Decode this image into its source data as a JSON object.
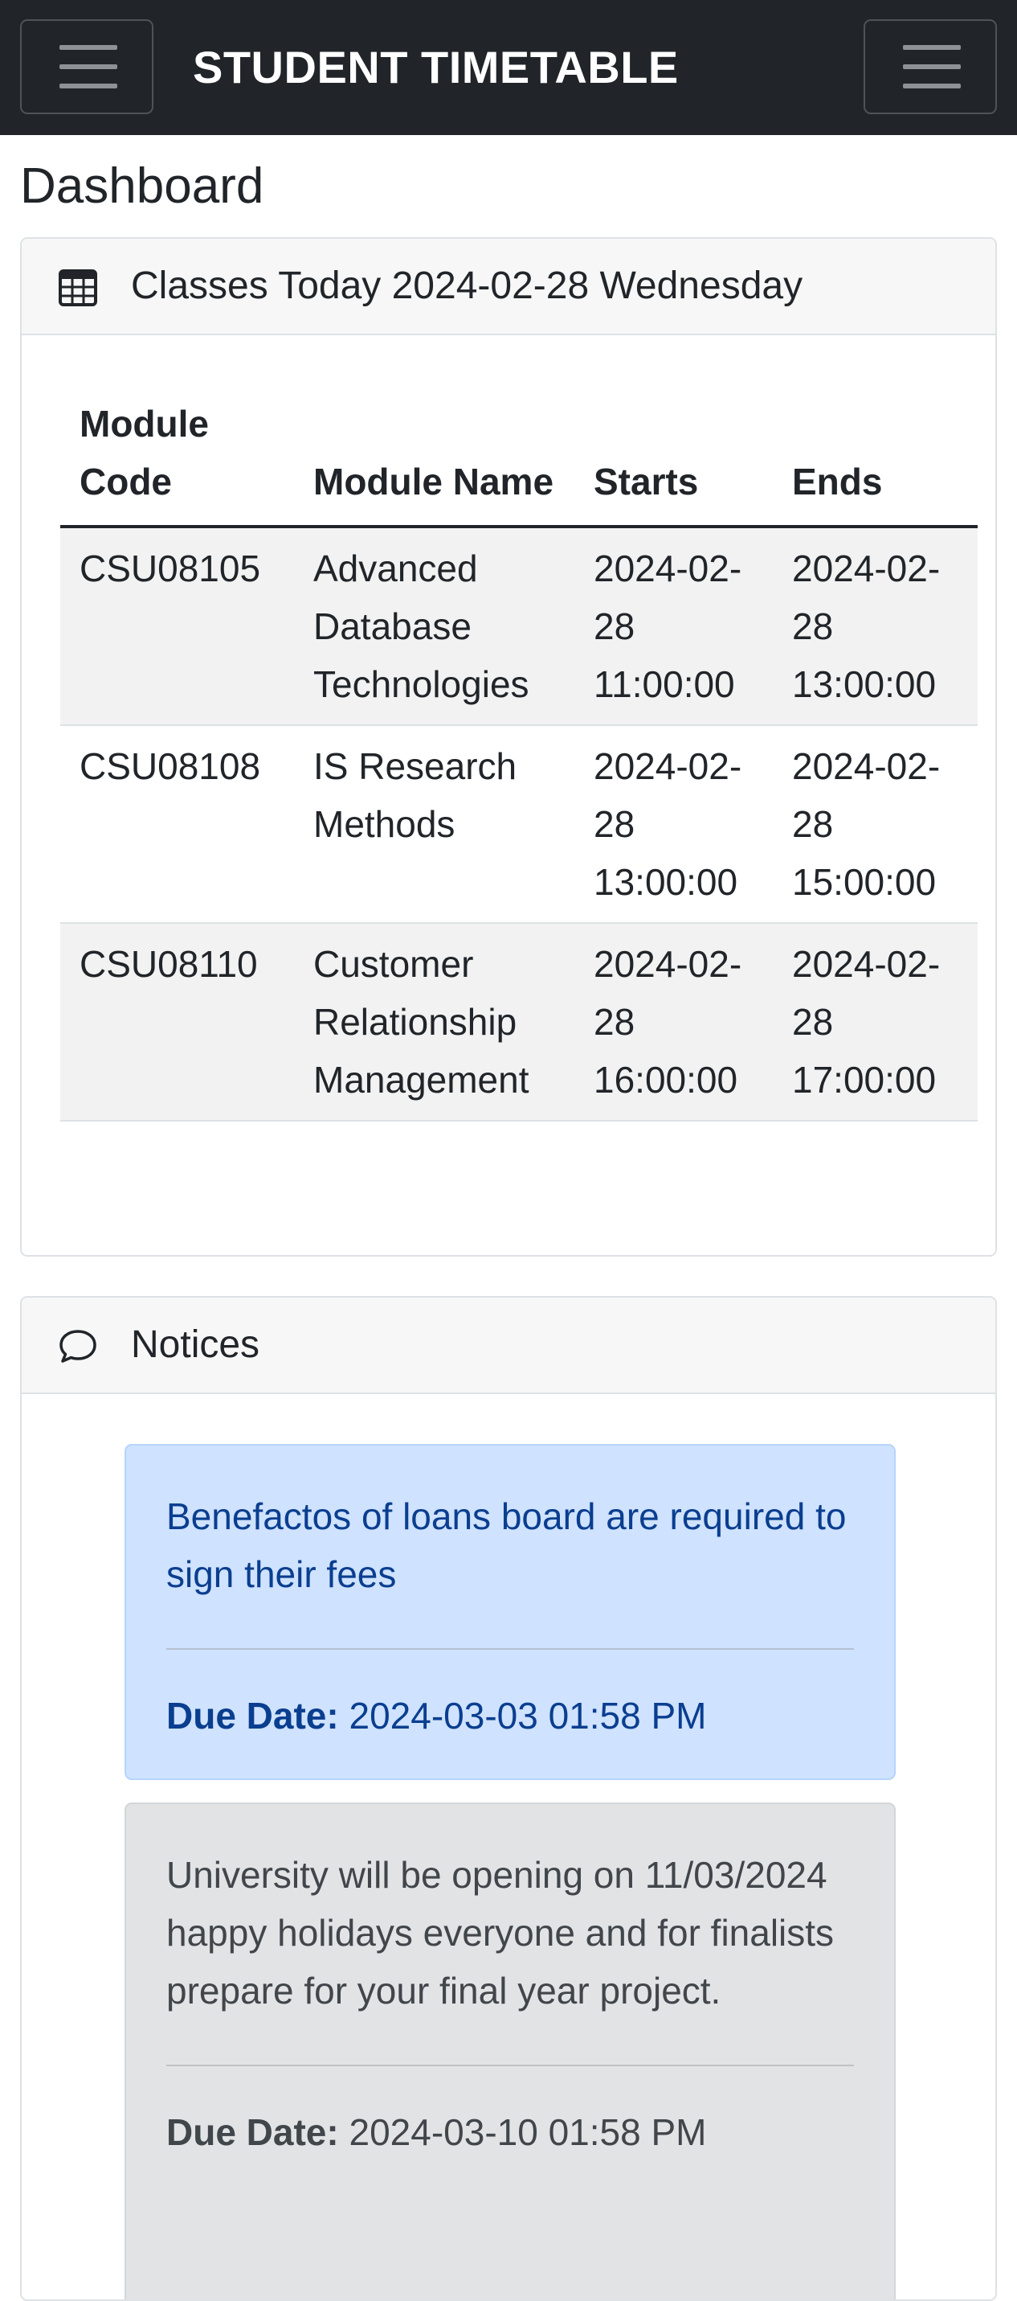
{
  "navbar": {
    "brand": "STUDENT TIMETABLE",
    "left_toggle_icon": "hamburger-menu-icon",
    "right_toggle_icon": "hamburger-menu-icon"
  },
  "page": {
    "title": "Dashboard"
  },
  "classes": {
    "icon": "table-grid-icon",
    "header": "Classes Today 2024-02-28 Wednesday",
    "columns": [
      "Module Code",
      "Module Name",
      "Starts",
      "Ends"
    ],
    "rows": [
      {
        "code": "CSU08105",
        "name": "Advanced Database Technologies",
        "starts": "2024-02-28 11:00:00",
        "ends": "2024-02-28 13:00:00"
      },
      {
        "code": "CSU08108",
        "name": "IS Research Methods",
        "starts": "2024-02-28 13:00:00",
        "ends": "2024-02-28 15:00:00"
      },
      {
        "code": "CSU08110",
        "name": "Customer Relationship Management",
        "starts": "2024-02-28 16:00:00",
        "ends": "2024-02-28 17:00:00"
      }
    ]
  },
  "notices": {
    "icon": "chat-bubble-icon",
    "header": "Notices",
    "items": [
      {
        "text": "Benefactos of loans board are required to sign their fees",
        "due_label": "Due Date:",
        "due_value": "2024-03-03 01:58 PM",
        "variant": "info"
      },
      {
        "text": "University will be opening on 11/03/2024 happy holidays everyone and for finalists prepare for your final year project.",
        "due_label": "Due Date:",
        "due_value": "2024-03-10 01:58 PM",
        "variant": "secondary"
      }
    ]
  },
  "colors": {
    "navbar_bg": "#212529",
    "notice_info_bg": "#cfe2ff",
    "notice_info_text": "#0a3e8f",
    "notice_secondary_bg": "#e2e3e5",
    "notice_secondary_text": "#41464b"
  }
}
